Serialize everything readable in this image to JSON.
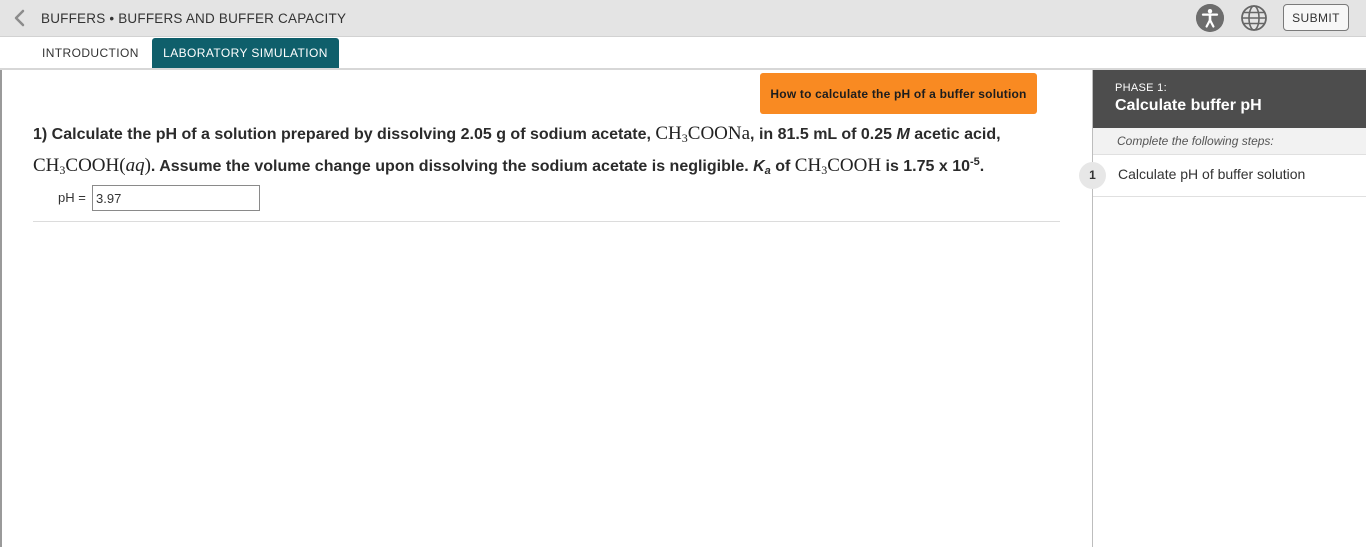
{
  "header": {
    "breadcrumb": "BUFFERS • BUFFERS AND BUFFER CAPACITY",
    "submit_label": "SUBMIT",
    "icons": {
      "back": "chevron-left-icon",
      "accessibility": "accessibility-icon",
      "language": "globe-icon"
    }
  },
  "tabs": [
    {
      "label": "INTRODUCTION",
      "active": false
    },
    {
      "label": "LABORATORY SIMULATION",
      "active": true
    }
  ],
  "main": {
    "help_button": "How to calculate the pH of a buffer solution",
    "question": {
      "p1": "1) Calculate the pH of a solution prepared by dissolving 2.05 g of sodium acetate, ",
      "chem_acetate_a": "CH",
      "chem_acetate_sub": "3",
      "chem_acetate_b": "COONa",
      "p2": ", in 81.5 mL of 0.25 ",
      "molar": "M",
      "p3": " acetic acid,",
      "chem_acid_a": "CH",
      "chem_acid_sub": "3",
      "chem_acid_b": "COOH(",
      "chem_acid_aq": "aq",
      "chem_acid_c": ")",
      "p4": ". Assume the volume change upon dissolving the sodium acetate is negligible. ",
      "ka_k": "K",
      "ka_sub": "a",
      "p5": " of ",
      "chem_ka_a": "CH",
      "chem_ka_sub": "3",
      "chem_ka_b": "COOH",
      "p6": " is 1.75 x 10",
      "exp": "-5",
      "p7": "."
    },
    "answer": {
      "label": "pH =",
      "value": "3.97"
    }
  },
  "sidebar": {
    "phase_number": "PHASE 1:",
    "phase_title": "Calculate buffer pH",
    "steps_intro": "Complete the following steps:",
    "steps": [
      {
        "number": "1",
        "label": "Calculate pH of buffer solution"
      }
    ]
  },
  "colors": {
    "tab_active": "#0f5f6b",
    "help_button": "#f98a22",
    "phase_header": "#4d4d4d",
    "topbar": "#e4e4e4"
  }
}
